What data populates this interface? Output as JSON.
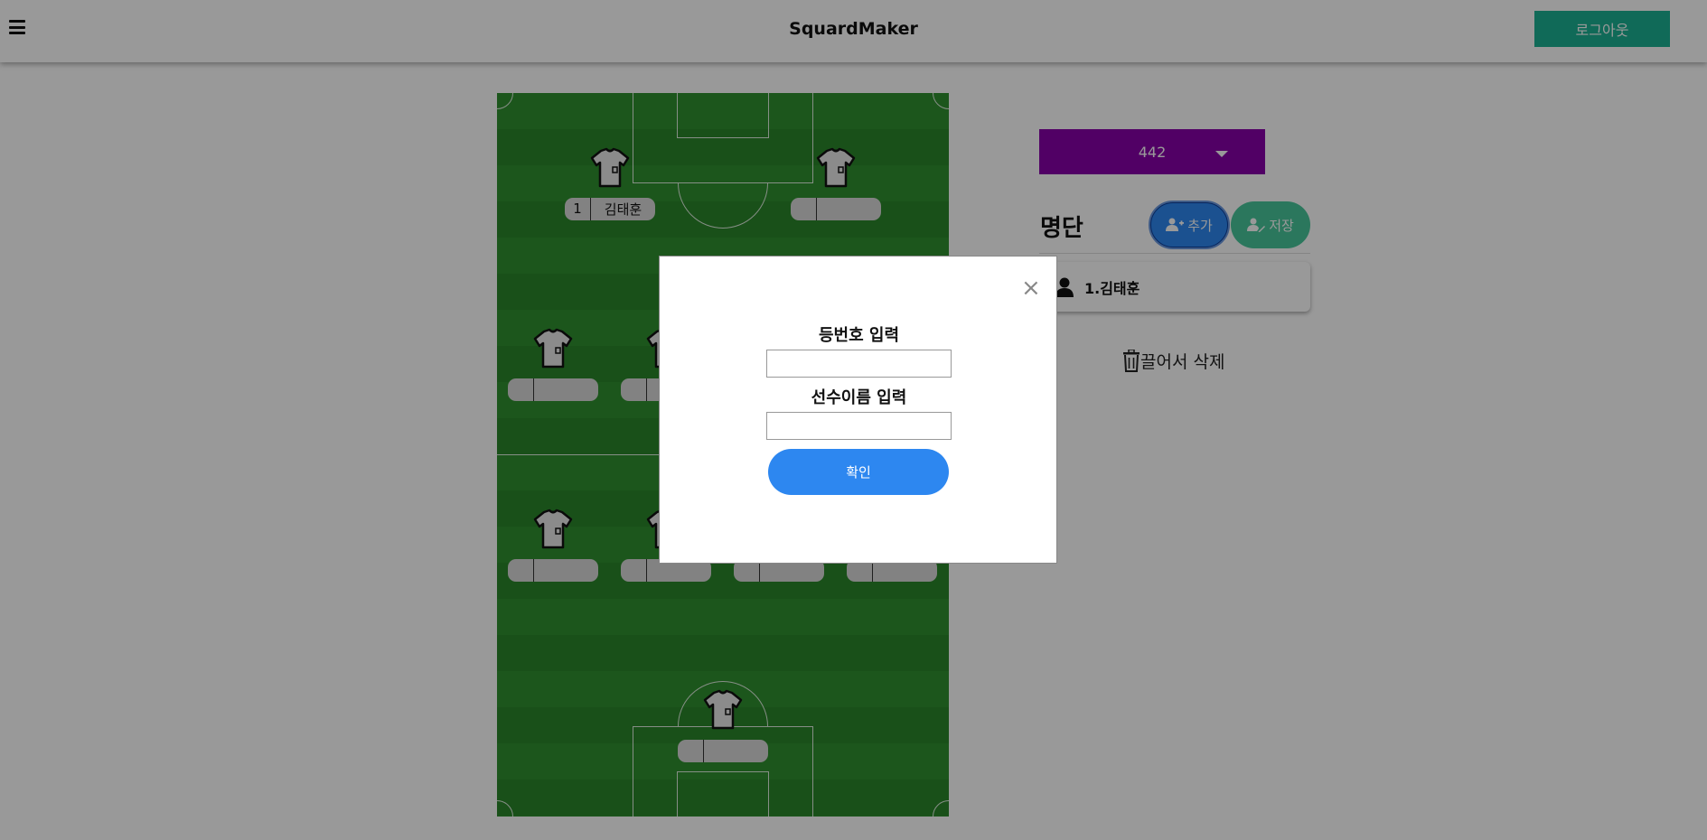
{
  "header": {
    "title": "SquardMaker",
    "logout_label": "로그아웃",
    "menu_icon": "hamburger-menu-icon"
  },
  "pitch": {
    "players": [
      {
        "number": "1",
        "name": "김태훈"
      },
      {
        "number": "",
        "name": ""
      },
      {
        "number": "",
        "name": ""
      },
      {
        "number": "",
        "name": ""
      },
      {
        "number": "",
        "name": ""
      },
      {
        "number": "",
        "name": ""
      },
      {
        "number": "",
        "name": ""
      },
      {
        "number": "",
        "name": ""
      },
      {
        "number": "",
        "name": ""
      },
      {
        "number": "",
        "name": ""
      },
      {
        "number": "",
        "name": ""
      }
    ]
  },
  "formation": {
    "selected": "442"
  },
  "roster": {
    "title": "명단",
    "add_label": "추가",
    "save_label": "저장",
    "items": [
      {
        "label": "1.김태훈"
      }
    ],
    "trash_label": "끌어서 삭제"
  },
  "modal": {
    "number_label": "등번호 입력",
    "name_label": "선수이름 입력",
    "number_value": "",
    "name_value": "",
    "confirm_label": "확인",
    "close_icon": "close-icon"
  },
  "colors": {
    "accent_purple": "#8800a8",
    "logout_green": "#1bb193",
    "add_blue": "#2d87f0",
    "save_green": "#49c69b",
    "pitch_green": "#2f8f2f"
  }
}
